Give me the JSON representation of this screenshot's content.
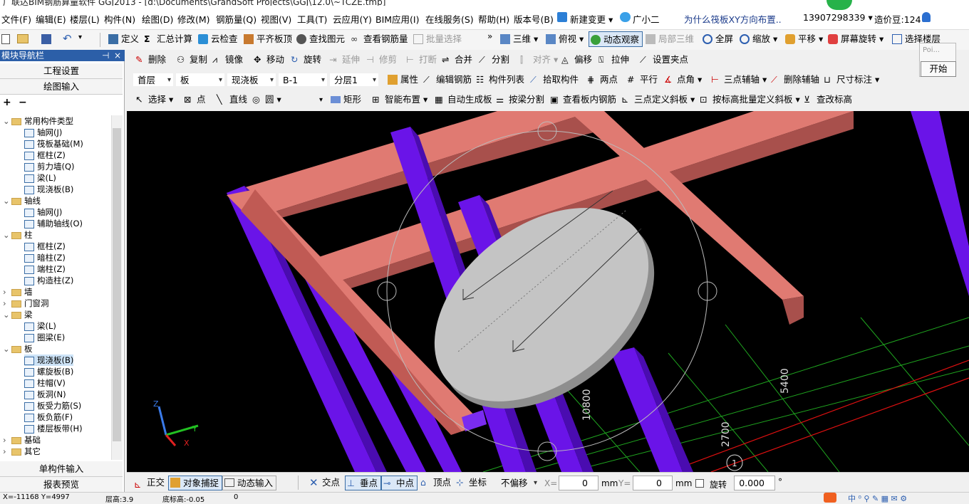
{
  "window": {
    "title": "广联达BIM钢筋算量软件 GGJ2013 - [d:\\Documents\\GrandSoft Projects\\GGJ\\12.0\\~TCZE.tmp]"
  },
  "menu": [
    "文件(F)",
    "编辑(E)",
    "楼层(L)",
    "构件(N)",
    "绘图(D)",
    "修改(M)",
    "钢筋量(Q)",
    "视图(V)",
    "工具(T)",
    "云应用(Y)",
    "BIM应用(I)",
    "在线服务(S)",
    "帮助(H)",
    "版本号(B)"
  ],
  "menu_right": {
    "new_change": "新建变更",
    "assistant": "广小二",
    "question": "为什么筏板XY方向布置..",
    "phone": "13907298339",
    "beans": "造价豆:124"
  },
  "toolbar1": [
    "定义",
    "汇总计算",
    "云检查",
    "平齐板顶",
    "查找图元",
    "查看钢筋量",
    "批量选择",
    "三维",
    "俯视",
    "动态观察",
    "局部三维",
    "全屏",
    "缩放",
    "平移",
    "屏幕旋转",
    "选择楼层"
  ],
  "toolbar2": [
    "删除",
    "复制",
    "镜像",
    "移动",
    "旋转",
    "延伸",
    "修剪",
    "打断",
    "合并",
    "分割",
    "对齐",
    "偏移",
    "拉伸",
    "设置夹点"
  ],
  "toolbar3": {
    "floor": "首层",
    "type": "板",
    "sub": "现浇板",
    "name": "B-1",
    "layer": "分层1",
    "items": [
      "属性",
      "编辑钢筋",
      "构件列表",
      "拾取构件",
      "两点",
      "平行",
      "点角",
      "三点辅轴",
      "删除辅轴",
      "尺寸标注"
    ]
  },
  "toolbar4": [
    "选择",
    "点",
    "直线",
    "圆",
    "矩形",
    "智能布置",
    "自动生成板",
    "按梁分割",
    "查看板内钢筋",
    "三点定义斜板",
    "按标高批量定义斜板",
    "查改标高"
  ],
  "nav": {
    "title": "模块导航栏",
    "btn_project": "工程设置",
    "btn_draw": "绘图输入",
    "btn_single": "单构件输入",
    "btn_report": "报表预览",
    "tree": [
      {
        "t": "常用构件类型",
        "lvl": 0,
        "folder": true,
        "open": true
      },
      {
        "t": "轴网(J)",
        "lvl": 1
      },
      {
        "t": "筏板基础(M)",
        "lvl": 1
      },
      {
        "t": "框柱(Z)",
        "lvl": 1
      },
      {
        "t": "剪力墙(Q)",
        "lvl": 1
      },
      {
        "t": "梁(L)",
        "lvl": 1
      },
      {
        "t": "现浇板(B)",
        "lvl": 1
      },
      {
        "t": "轴线",
        "lvl": 0,
        "folder": true,
        "open": true
      },
      {
        "t": "轴网(J)",
        "lvl": 1
      },
      {
        "t": "辅助轴线(O)",
        "lvl": 1
      },
      {
        "t": "柱",
        "lvl": 0,
        "folder": true,
        "open": true
      },
      {
        "t": "框柱(Z)",
        "lvl": 1
      },
      {
        "t": "暗柱(Z)",
        "lvl": 1
      },
      {
        "t": "端柱(Z)",
        "lvl": 1
      },
      {
        "t": "构造柱(Z)",
        "lvl": 1
      },
      {
        "t": "墙",
        "lvl": 0,
        "folder": true,
        "open": false
      },
      {
        "t": "门窗洞",
        "lvl": 0,
        "folder": true,
        "open": false
      },
      {
        "t": "梁",
        "lvl": 0,
        "folder": true,
        "open": true
      },
      {
        "t": "梁(L)",
        "lvl": 1
      },
      {
        "t": "圈梁(E)",
        "lvl": 1
      },
      {
        "t": "板",
        "lvl": 0,
        "folder": true,
        "open": true
      },
      {
        "t": "现浇板(B)",
        "lvl": 1,
        "sel": true
      },
      {
        "t": "螺旋板(B)",
        "lvl": 1
      },
      {
        "t": "柱帽(V)",
        "lvl": 1
      },
      {
        "t": "板洞(N)",
        "lvl": 1
      },
      {
        "t": "板受力筋(S)",
        "lvl": 1
      },
      {
        "t": "板负筋(F)",
        "lvl": 1
      },
      {
        "t": "楼层板带(H)",
        "lvl": 1
      },
      {
        "t": "基础",
        "lvl": 0,
        "folder": true,
        "open": false
      },
      {
        "t": "其它",
        "lvl": 0,
        "folder": true,
        "open": false
      }
    ]
  },
  "viewport": {
    "dims": [
      "10800",
      "5400",
      "2700"
    ],
    "axis_label": "1",
    "axes": [
      "Z",
      "Y",
      "X"
    ]
  },
  "status": {
    "items": [
      "正交",
      "对象捕捉",
      "动态输入",
      "交点",
      "垂点",
      "中点",
      "顶点",
      "坐标"
    ],
    "offset": "不偏移",
    "x_label": "X=",
    "x_val": "0",
    "y_label": "Y=",
    "y_val": "0",
    "unit": "mm",
    "rotate": "旋转",
    "rot_val": "0.000",
    "deg": "°"
  },
  "popup": {
    "field": "Poi...",
    "start": "开始"
  },
  "bottom": {
    "coords": "X=-11168  Y=4997",
    "floor_h": "层高:3.9",
    "base_h": "底标高:-0.05",
    "zero": "0"
  },
  "colors": {
    "beam": "#e07a72",
    "column": "#6a14e8",
    "slab": "#c4c4c4",
    "grid": "#1fa51f",
    "redline": "#e01010",
    "nav_header": "#2c5fa8"
  }
}
